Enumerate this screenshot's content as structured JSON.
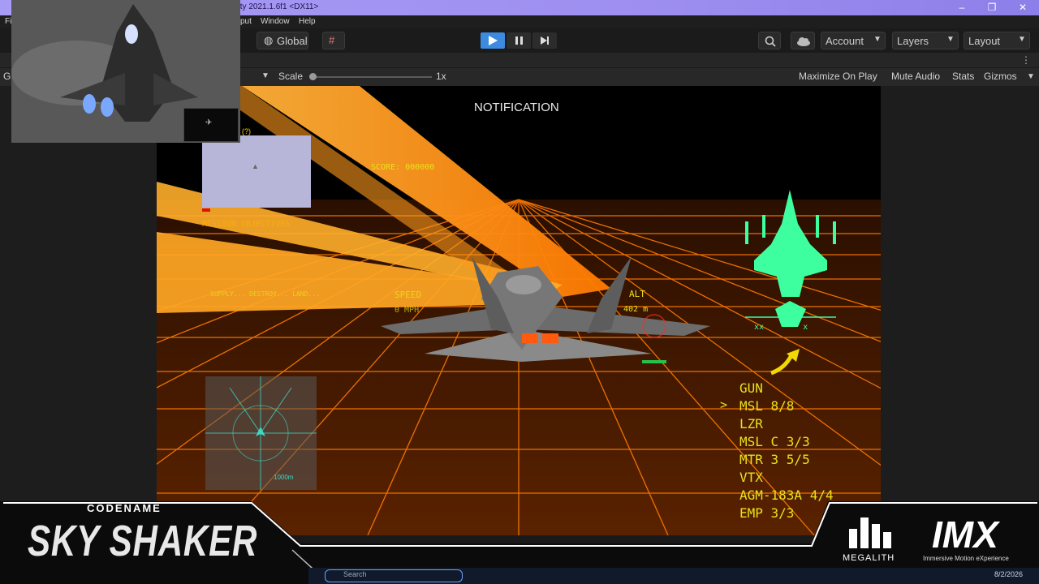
{
  "window": {
    "title": "nity 2021.1.6f1 <DX11>",
    "minimize": "–",
    "restore": "❐",
    "close": "✕"
  },
  "menu": {
    "items": [
      "Fil",
      "put",
      "Window",
      "Help"
    ]
  },
  "toolbar": {
    "global_label": "Global",
    "account_label": "Account",
    "layers_label": "Layers",
    "layout_label": "Layout"
  },
  "gameview": {
    "tab_label": "Ga",
    "scale_label": "Scale",
    "scale_value": "1x",
    "maximize_label": "Maximize On Play",
    "mute_label": "Mute Audio",
    "stats_label": "Stats",
    "gizmos_label": "Gizmos"
  },
  "hud": {
    "notification": "NOTIFICATION",
    "score": "SCORE: 000000",
    "mission_objectives": "MISSION OBJECTIVES",
    "objective_line": "SUPPLY... DESTROY... LAND...",
    "speed_label": "SPEED",
    "speed_value": "0 MPH",
    "alt_label": "ALT",
    "alt_value": "402 m",
    "minimap_marker": "(?)",
    "radar_range": "1000m",
    "weapon_cursor": ">",
    "weapons": [
      "GUN",
      "MSL 8/8",
      "LZR",
      "MSL C 3/3",
      "MTR 3 5/5",
      "VTX",
      "AGM-183A 4/4",
      "EMP 3/3"
    ],
    "aircraft_marks": "xx        x",
    "colors": {
      "hud_yellow": "#e9e21a",
      "hud_green": "#3dffa0",
      "grid_orange": "#ff7a00"
    }
  },
  "branding": {
    "codename": "CODENAME",
    "game_title": "SKY SHAKER",
    "megalith": "MEGALITH",
    "imx": "IMX",
    "imx_tagline": "Immersive Motion eXperience"
  },
  "taskbar": {
    "search": "Search",
    "date": "8/2/2026"
  }
}
